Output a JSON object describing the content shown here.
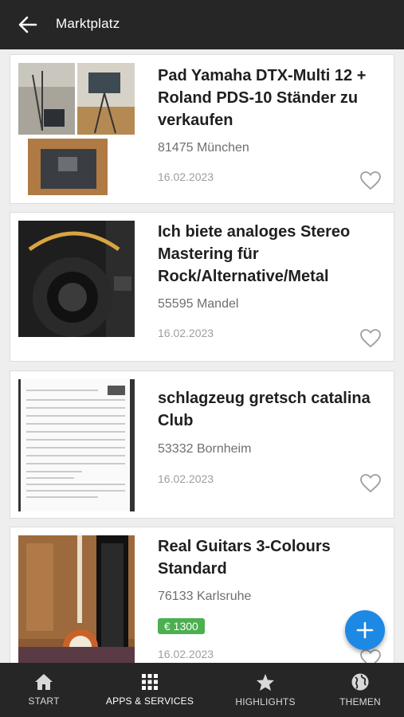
{
  "header": {
    "title": "Marktplatz",
    "back_icon": "arrow-left-icon"
  },
  "listings": [
    {
      "title": "Pad Yamaha DTX-Multi 12 + Roland PDS-10 Ständer zu verkaufen",
      "location": "81475 München",
      "date": "16.02.2023",
      "favorite": false
    },
    {
      "title": "Ich biete analoges Stereo Mastering für Rock/Alternative/Metal",
      "location": "55595 Mandel",
      "date": "16.02.2023",
      "favorite": false
    },
    {
      "title": "schlagzeug gretsch catalina Club",
      "location": "53332 Bornheim",
      "date": "16.02.2023",
      "favorite": false
    },
    {
      "title": "Real Guitars 3-Colours Standard",
      "location": "76133 Karlsruhe",
      "price": "€ 1300",
      "date": "16.02.2023",
      "favorite": false
    }
  ],
  "fab": {
    "icon": "plus-icon"
  },
  "nav": [
    {
      "label": "START",
      "icon": "home-icon"
    },
    {
      "label": "APPS & SERVICES",
      "icon": "grid-icon",
      "active": true
    },
    {
      "label": "HIGHLIGHTS",
      "icon": "star-icon"
    },
    {
      "label": "THEMEN",
      "icon": "globe-icon"
    }
  ],
  "colors": {
    "topbar": "#262626",
    "fab": "#1e88e5",
    "price_badge": "#4caf50"
  }
}
